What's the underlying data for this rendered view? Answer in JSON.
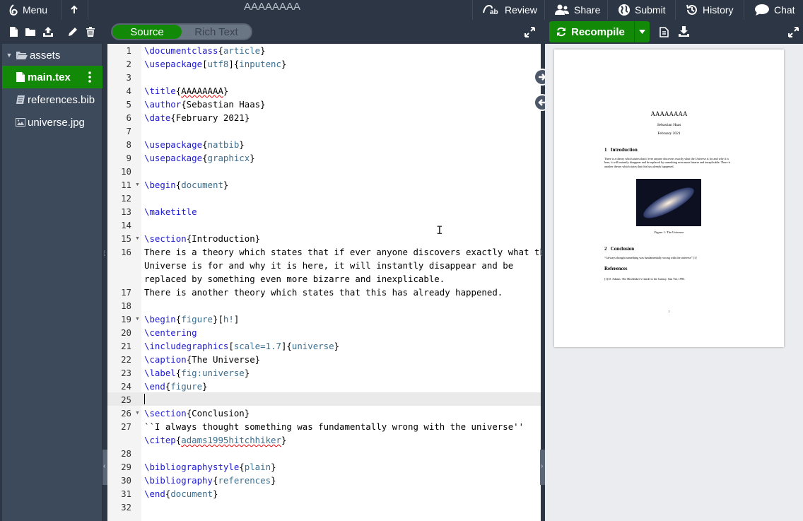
{
  "topbar": {
    "menu_label": "Menu",
    "project_title": "AAAAAAAA",
    "review_label": "Review",
    "share_label": "Share",
    "submit_label": "Submit",
    "history_label": "History",
    "chat_label": "Chat"
  },
  "editor_toggle": {
    "source_label": "Source",
    "rich_text_label": "Rich Text",
    "selected": "Source"
  },
  "file_tree": {
    "items": [
      {
        "label": "assets",
        "type": "folder"
      },
      {
        "label": "main.tex",
        "type": "file",
        "active": true
      },
      {
        "label": "references.bib",
        "type": "bib"
      },
      {
        "label": "universe.jpg",
        "type": "image"
      }
    ]
  },
  "preview_toolbar": {
    "recompile_label": "Recompile"
  },
  "editor": {
    "active_line": "25",
    "lines": [
      {
        "n": "1",
        "text": "\\documentclass{article}"
      },
      {
        "n": "2",
        "text": "\\usepackage[utf8]{inputenc}"
      },
      {
        "n": "3",
        "text": ""
      },
      {
        "n": "4",
        "text": "\\title{AAAAAAAA}"
      },
      {
        "n": "5",
        "text": "\\author{Sebastian Haas}"
      },
      {
        "n": "6",
        "text": "\\date{February 2021}"
      },
      {
        "n": "7",
        "text": ""
      },
      {
        "n": "8",
        "text": "\\usepackage{natbib}"
      },
      {
        "n": "9",
        "text": "\\usepackage{graphicx}"
      },
      {
        "n": "10",
        "text": ""
      },
      {
        "n": "11",
        "text": "\\begin{document}"
      },
      {
        "n": "12",
        "text": ""
      },
      {
        "n": "13",
        "text": "\\maketitle"
      },
      {
        "n": "14",
        "text": ""
      },
      {
        "n": "15",
        "text": "\\section{Introduction}"
      },
      {
        "n": "16",
        "text": "There is a theory which states that if ever anyone discovers exactly what the Universe is for and why it is here, it will instantly disappear and be replaced by something even more bizarre and inexplicable."
      },
      {
        "n": "17",
        "text": "There is another theory which states that this has already happened."
      },
      {
        "n": "18",
        "text": ""
      },
      {
        "n": "19",
        "text": "\\begin{figure}[h!]"
      },
      {
        "n": "20",
        "text": "\\centering"
      },
      {
        "n": "21",
        "text": "\\includegraphics[scale=1.7]{universe}"
      },
      {
        "n": "22",
        "text": "\\caption{The Universe}"
      },
      {
        "n": "23",
        "text": "\\label{fig:universe}"
      },
      {
        "n": "24",
        "text": "\\end{figure}"
      },
      {
        "n": "25",
        "text": ""
      },
      {
        "n": "26",
        "text": "\\section{Conclusion}"
      },
      {
        "n": "27",
        "text": "``I always thought something was fundamentally wrong with the universe'' \\citep{adams1995hitchhiker}"
      },
      {
        "n": "28",
        "text": ""
      },
      {
        "n": "29",
        "text": "\\bibliographystyle{plain}"
      },
      {
        "n": "30",
        "text": "\\bibliography{references}"
      },
      {
        "n": "31",
        "text": "\\end{document}"
      },
      {
        "n": "32",
        "text": ""
      }
    ]
  },
  "pdf_page": {
    "title": "AAAAAAAA",
    "author": "Sebastian Haas",
    "date": "February 2021",
    "sec1_num": "1",
    "sec1_title": "Introduction",
    "sec1_text": "There is a theory which states that if ever anyone discovers exactly what the Universe is for and why it is here, it will instantly disappear and be replaced by something even more bizarre and inexplicable. There is another theory which states that this has already happened.",
    "figure_caption": "Figure 1: The Universe",
    "sec2_num": "2",
    "sec2_title": "Conclusion",
    "sec2_text": "“I always thought something was fundamentally wrong with the universe” [1]",
    "references_title": "References",
    "reference_1": "[1] D. Adams. The Hitchhiker’s Guide to the Galaxy. San Val, 1995.",
    "page_number": "1"
  },
  "colors": {
    "accent_green": "#138a07",
    "chrome": "#2c3645",
    "sidebar": "#3d4a5c"
  },
  "icons": [
    "overleaf-logo-icon",
    "back-arrow-icon",
    "review-icon",
    "share-icon",
    "globe-icon",
    "history-icon",
    "chat-icon",
    "new-file-icon",
    "new-folder-icon",
    "upload-icon",
    "rename-icon",
    "delete-icon",
    "expand-icon",
    "refresh-icon",
    "caret-down-icon",
    "document-icon",
    "download-icon",
    "arrow-right-icon",
    "arrow-left-icon"
  ]
}
